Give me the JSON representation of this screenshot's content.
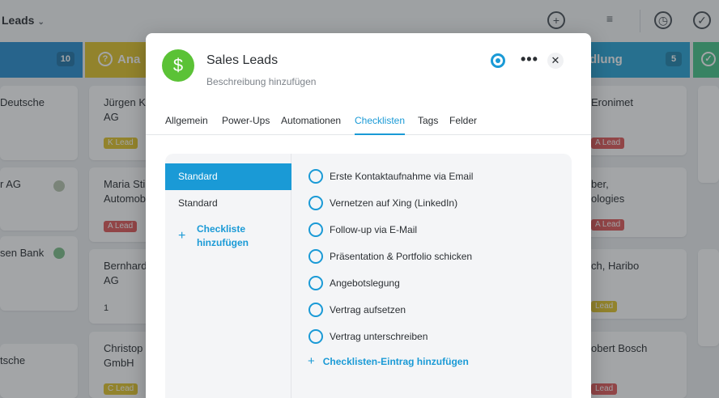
{
  "board": {
    "title": "Leads",
    "columns": [
      {
        "title": "",
        "count": "10",
        "color": "#2a8fd0"
      },
      {
        "title": "Ana",
        "count": "",
        "color": "#e2c52b"
      },
      {
        "title": "dlung",
        "count": "5",
        "color": "#2aa4d6"
      },
      {
        "title": "",
        "count": "",
        "color": "#48c58a"
      }
    ],
    "cards_left": [
      {
        "name": "Deutsche"
      },
      {
        "name": "r AG"
      },
      {
        "name": "sen Bank"
      },
      {
        "name": "tsche"
      }
    ],
    "cards_mid": [
      {
        "name": "Jürgen K",
        "name2": "AG",
        "tag": "K Lead"
      },
      {
        "name": "Maria Sti",
        "name2": "Automob",
        "tag": "A Lead"
      },
      {
        "name": "Bernhard",
        "name2": "AG",
        "meta": "1"
      },
      {
        "name": "Christop",
        "name2": "GmbH",
        "tag": "C Lead"
      }
    ],
    "cards_right": [
      {
        "name": "Eronimet",
        "tag": "A Lead"
      },
      {
        "name": "ber,",
        "name2": "ologies",
        "tag": "A Lead"
      },
      {
        "name": "ch, Haribo",
        "tag": "Lead"
      },
      {
        "name": "obert Bosch",
        "tag": "Lead"
      }
    ]
  },
  "modal": {
    "icon_glyph": "$",
    "icon_name": "dollar-icon",
    "title": "Sales Leads",
    "subtitle": "Beschreibung hinzufügen",
    "more_glyph": "•••",
    "close_glyph": "✕",
    "tabs": [
      {
        "label": "Allgemein"
      },
      {
        "label": "Power-Ups"
      },
      {
        "label": "Automationen"
      },
      {
        "label": "Checklisten"
      },
      {
        "label": "Tags"
      },
      {
        "label": "Felder"
      }
    ],
    "active_tab": "Checklisten",
    "checklists": [
      {
        "label": "Standard"
      },
      {
        "label": "Standard"
      }
    ],
    "add_checklist_label": "Checkliste hinzufügen",
    "items": [
      {
        "label": "Erste Kontaktaufnahme via Email"
      },
      {
        "label": "Vernetzen auf Xing (LinkedIn)"
      },
      {
        "label": "Follow-up via E-Mail"
      },
      {
        "label": "Präsentation & Portfolio schicken"
      },
      {
        "label": "Angebotslegung"
      },
      {
        "label": "Vertrag aufsetzen"
      },
      {
        "label": "Vertrag unterschreiben"
      }
    ],
    "add_item_label": "Checklisten-Eintrag hinzufügen",
    "plus_glyph": "+"
  },
  "colors": {
    "accent": "#1a9ad6",
    "icon_bg": "#5bc236"
  }
}
